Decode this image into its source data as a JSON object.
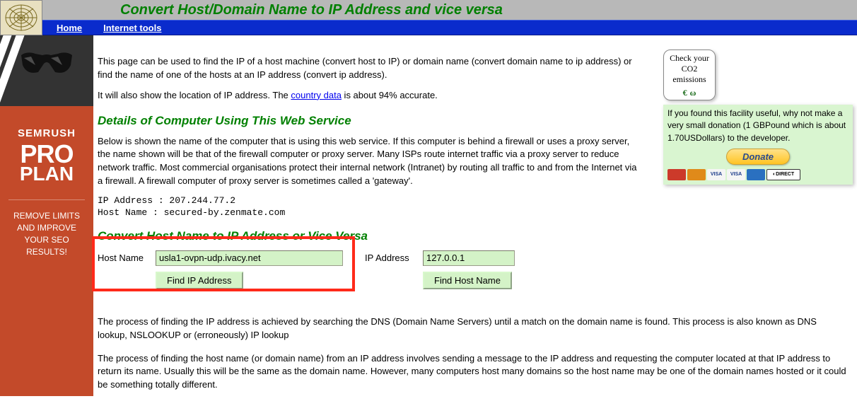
{
  "header": {
    "title": "Convert Host/Domain Name to IP Address and vice versa",
    "nav": {
      "home": "Home",
      "tools": "Internet tools"
    }
  },
  "ad": {
    "brand": "SEMRUSH",
    "line1": "PRO",
    "line2": "PLAN",
    "msg": "REMOVE LIMITS AND IMPROVE YOUR SEO RESULTS!"
  },
  "intro": {
    "p1": "This page can be used to find the IP of a host machine (convert host to IP) or domain name (convert domain name to ip address) or find the name of one of the hosts at an IP address (convert ip address).",
    "p2_a": "It will also show the location of IP address. The ",
    "p2_link": "country data",
    "p2_b": " is about 94% accurate."
  },
  "details": {
    "heading": "Details of Computer Using This Web Service",
    "p": "Below is shown the name of the computer that is using this web service. If this computer is behind a firewall or uses a proxy server, the name shown will be that of the firewall computer or proxy server. Many ISPs route internet traffic via a proxy server to reduce network traffic. Most commercial organisations protect their internal network (Intranet) by routing all traffic to and from the Internet via a firewall. A firewall computer of proxy server is sometimes called a 'gateway'.",
    "ip_line": "IP Address : 207.244.77.2",
    "host_line": "Host Name  : secured-by.zenmate.com"
  },
  "convert": {
    "heading": "Convert Host Name to IP Address or Vice Versa",
    "host_label": "Host Name",
    "host_value": "usla1-ovpn-udp.ivacy.net",
    "host_btn": "Find IP Address",
    "ip_label": "IP Address",
    "ip_value": "127.0.0.1",
    "ip_btn": "Find Host Name"
  },
  "explain": {
    "p1": "The process of finding the IP address is achieved by searching the DNS (Domain Name Servers) until a match on the domain name is found. This process is also known as DNS lookup, NSLOOKUP or (erroneously) IP lookup",
    "p2": "The process of finding the host name (or domain name) from an IP address involves sending a message to the IP address and requesting the computer located at that IP address to return its name. Usually this will be the same as the domain name. However, many computers host many domains so the host name may be one of the domain names hosted or it could be something totally different."
  },
  "co2": {
    "l1": "Check your",
    "l2": "CO2",
    "l3": "emissions"
  },
  "donate": {
    "text": "If you found this facility useful, why not make a very small donation (1 GBPound which is about 1.70USDollars) to the developer.",
    "btn": "Donate"
  }
}
